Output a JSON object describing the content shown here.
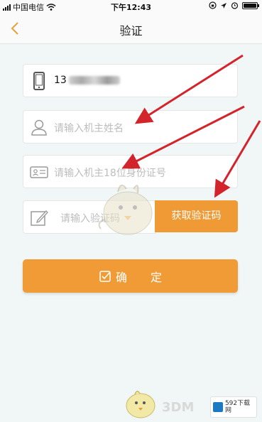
{
  "status_bar": {
    "carrier": "中国电信",
    "time": "下午12:43"
  },
  "nav": {
    "title": "验证"
  },
  "form": {
    "phone_value": "13",
    "name_placeholder": "请输入机主姓名",
    "id_placeholder": "请输入机主18位身份证号",
    "code_placeholder": "请输入验证码",
    "get_code_label": "获取验证码",
    "confirm_label": "确 定"
  },
  "watermarks": {
    "brand_3dm": "3DM",
    "site_592": "592下载网"
  },
  "colors": {
    "accent": "#ef9a34",
    "arrow": "#d4242b",
    "background": "#f1f6f6"
  },
  "icons": {
    "phone_field": "mobile-phone-icon",
    "name_field": "person-icon",
    "id_field": "id-card-icon",
    "code_field": "edit-pencil-icon",
    "confirm": "check-square-icon",
    "back": "chevron-left-icon"
  }
}
